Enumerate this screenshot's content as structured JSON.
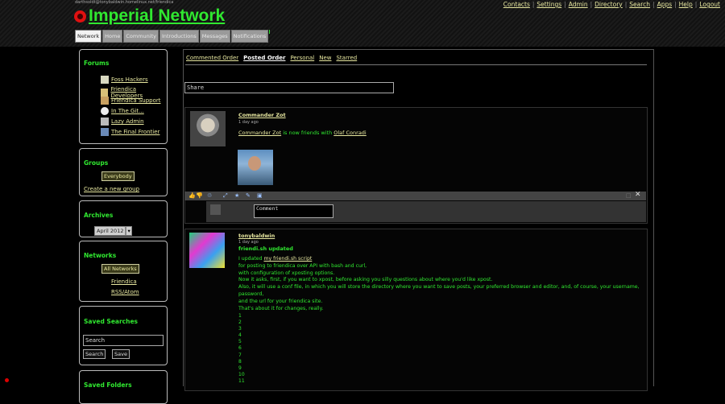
{
  "header": {
    "user_address": "darthsoldt@tonybaldwin.homelinux.net/friendica",
    "site_name": "Imperial Network",
    "nav": [
      "Contacts",
      "Settings",
      "Admin",
      "Directory",
      "Search",
      "Apps",
      "Help",
      "Logout"
    ],
    "tabs": [
      "Network",
      "Home",
      "Community",
      "Introductions",
      "Messages",
      "Notifications"
    ],
    "active_tab": "Network"
  },
  "sidebar": {
    "forums": {
      "title": "Forums",
      "items": [
        "Foss Hackers",
        "Friendica Developers",
        "Friendica Support",
        "In The Git...",
        "Lazy Admin",
        "The Final Frontier"
      ]
    },
    "groups": {
      "title": "Groups",
      "everybody": "Everybody",
      "create": "Create a new group"
    },
    "archives": {
      "title": "Archives",
      "selected": "April 2012"
    },
    "networks": {
      "title": "Networks",
      "all": "All Networks",
      "friendica": "Friendica",
      "rss": "RSS/Atom"
    },
    "saved_searches": {
      "title": "Saved Searches",
      "placeholder": "Search",
      "search_btn": "Search",
      "save_btn": "Save"
    },
    "saved_folders": {
      "title": "Saved Folders"
    }
  },
  "main": {
    "subtabs": [
      "Commented Order",
      "Posted Order",
      "Personal",
      "New",
      "Starred"
    ],
    "active_subtab": "Posted Order",
    "share_label": "Share",
    "post1": {
      "author": "Commander Zot",
      "time": "1 day ago",
      "text_author": "Commander Zot",
      "text_middle": " is now friends with ",
      "text_friend": "Olaf Conradi",
      "comment_placeholder": "Comment"
    },
    "post2": {
      "author": "tonybaldwin",
      "time": "1 day ago",
      "title": "friendi.sh updated",
      "line1_pre": "I updated ",
      "line1_link": "my friendi.sh script",
      "lines": [
        "for posting to friendica over API with bash and curl,",
        "with configuration of xposting options.",
        "Now it asks, first, if you want to xpost, before asking you silly questions about where you'd like xpost.",
        "Also, it will use a conf file, in which you will store the directory where you want to save posts, your preferred browser and editor, and, of course, your username, password,",
        "and the url for your friendica site.",
        "That's about it for changes, really."
      ],
      "numbers": [
        "1",
        "2",
        "3",
        "4",
        "5",
        "6",
        "7",
        "8",
        "9",
        "10",
        "11"
      ]
    }
  },
  "colors": {
    "accent_green": "#30e830",
    "link": "#e8e8a0",
    "logo_red": "#e01010"
  }
}
